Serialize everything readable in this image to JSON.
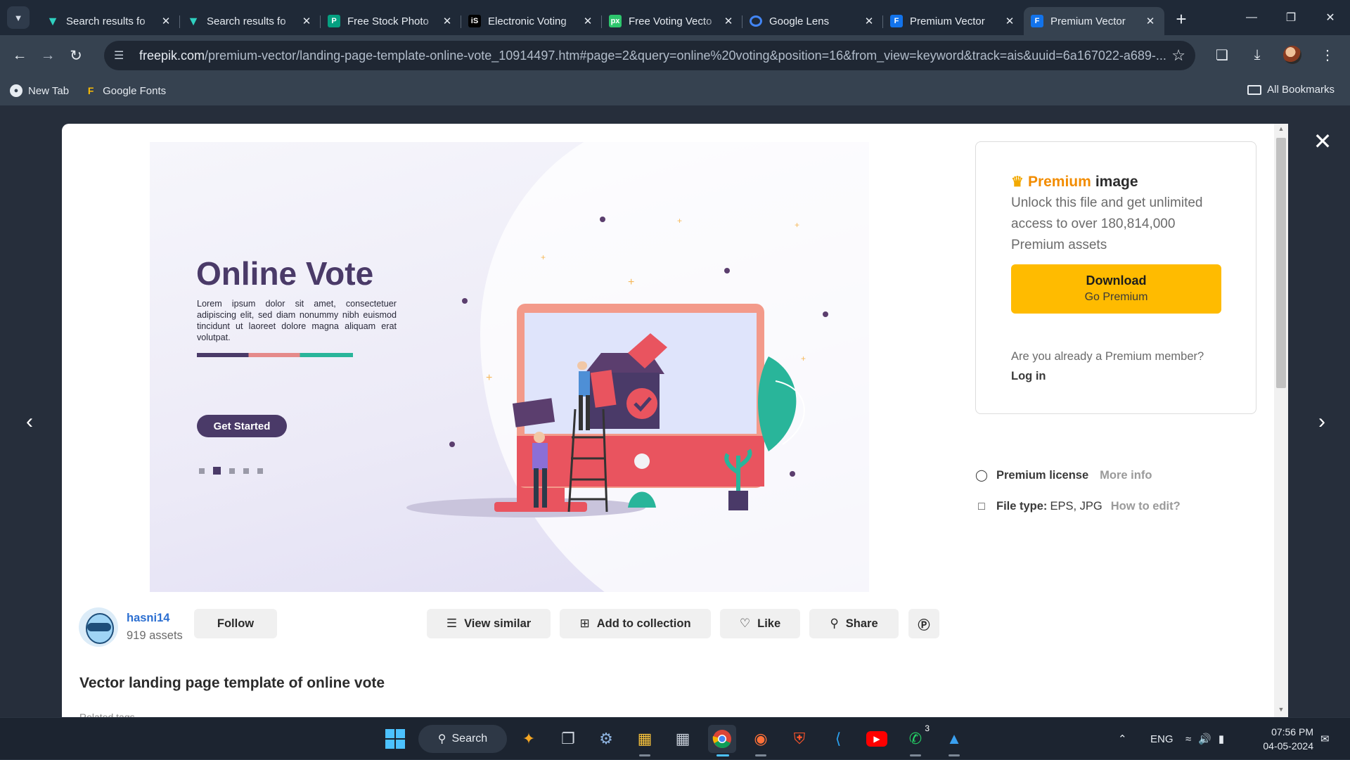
{
  "browser": {
    "tabs": [
      {
        "title": "Search results fo",
        "icon": "freepik-v-icon",
        "active": false
      },
      {
        "title": "Search results fo",
        "icon": "freepik-v-icon",
        "active": false
      },
      {
        "title": "Free Stock Photo",
        "icon": "pexels-icon",
        "active": false
      },
      {
        "title": "Electronic Voting",
        "icon": "istock-icon",
        "active": false
      },
      {
        "title": "Free Voting Vecto",
        "icon": "pixabay-icon",
        "active": false
      },
      {
        "title": "Google Lens",
        "icon": "google-lens-icon",
        "active": false
      },
      {
        "title": "Premium Vector",
        "icon": "freepik-f-icon",
        "active": false
      },
      {
        "title": "Premium Vector",
        "icon": "freepik-f-icon",
        "active": true
      }
    ],
    "url_host": "freepik.com",
    "url_path": "/premium-vector/landing-page-template-online-vote_10914497.htm#page=2&query=online%20voting&position=16&from_view=keyword&track=ais&uuid=6a167022-a689-...",
    "bookmarks": [
      {
        "label": "New Tab",
        "icon": "globe-icon"
      },
      {
        "label": "Google Fonts",
        "icon": "google-fonts-icon"
      }
    ],
    "all_bookmarks": "All Bookmarks"
  },
  "preview": {
    "heading": "Online Vote",
    "body": "Lorem ipsum dolor sit amet, consectetuer adipiscing elit, sed diam nonummy nibh euismod tincidunt ut laoreet dolore magna aliquam erat volutpat.",
    "cta": "Get Started"
  },
  "premium": {
    "premium_word": "Premium",
    "image_word": "image",
    "description": "Unlock this file and get unlimited access to over 180,814,000 Premium assets",
    "download_label": "Download",
    "download_sub": "Go Premium",
    "member_question": "Are you already a Premium member?",
    "login": "Log in"
  },
  "meta": {
    "license_label": "Premium license",
    "license_link": "More info",
    "filetype_label": "File type:",
    "filetype_value": "EPS, JPG",
    "filetype_link": "How to edit?"
  },
  "author": {
    "name": "hasni14",
    "assets": "919 assets",
    "follow": "Follow"
  },
  "actions": {
    "view_similar": "View similar",
    "add_collection": "Add to collection",
    "like": "Like",
    "share": "Share"
  },
  "content": {
    "title": "Vector landing page template of online vote",
    "related_tags": "Related tags"
  },
  "taskbar": {
    "search": "Search",
    "language": "ENG",
    "time": "07:56 PM",
    "date": "04-05-2024",
    "whatsapp_badge": "3"
  },
  "colors": {
    "accent_orange": "#f28c00",
    "download_yellow": "#ffbb00",
    "author_link": "#2c6fd1",
    "preview_purple": "#4a3a68"
  }
}
